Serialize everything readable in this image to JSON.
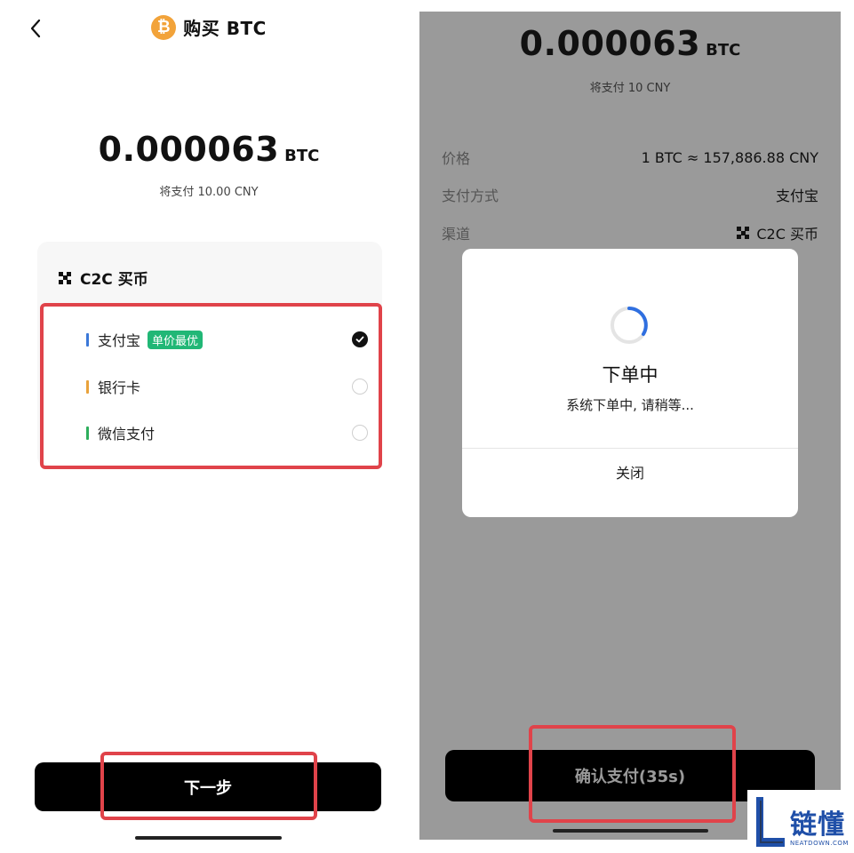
{
  "left": {
    "header": {
      "coin_glyph": "₿",
      "title": "购买 BTC"
    },
    "amount": {
      "value": "0.000063",
      "unit": "BTC"
    },
    "pay_text": "将支付 10.00 CNY",
    "channel": {
      "title": "C2C 买币"
    },
    "options": [
      {
        "label": "支付宝",
        "badge": "单价最优",
        "color": "#3b78d8",
        "selected": true
      },
      {
        "label": "银行卡",
        "badge": "",
        "color": "#e9a23b",
        "selected": false
      },
      {
        "label": "微信支付",
        "badge": "",
        "color": "#2dae5c",
        "selected": false
      }
    ],
    "next_label": "下一步"
  },
  "right": {
    "amount": {
      "value": "0.000063",
      "unit": "BTC"
    },
    "pay_text": "将支付 10 CNY",
    "info": [
      {
        "key": "价格",
        "value": "1 BTC ≈ 157,886.88 CNY"
      },
      {
        "key": "支付方式",
        "value": "支付宝"
      },
      {
        "key": "渠道",
        "value": "C2C 买币"
      }
    ],
    "modal": {
      "title": "下单中",
      "subtitle": "系统下单中, 请稍等...",
      "close_label": "关闭"
    },
    "confirm_label": "确认支付(35s)"
  },
  "watermark": {
    "text": "链懂",
    "sub": "NEATDOWN.COM"
  },
  "colors": {
    "highlight": "#e0434a",
    "badge": "#21b776",
    "btc": "#f2a33a"
  }
}
